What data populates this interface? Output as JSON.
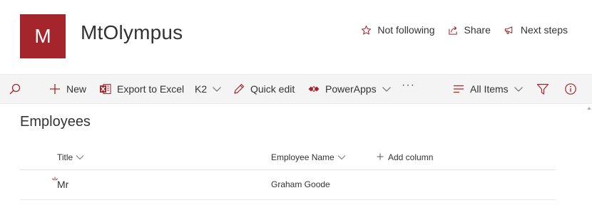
{
  "site": {
    "logo_letter": "M",
    "title": "MtOlympus"
  },
  "header_actions": {
    "follow": "Not following",
    "share": "Share",
    "next_steps": "Next steps"
  },
  "command_bar": {
    "new": "New",
    "export": "Export to Excel",
    "k2": "K2",
    "quick_edit": "Quick edit",
    "powerapps": "PowerApps",
    "more": "···",
    "view": "All Items"
  },
  "list": {
    "title": "Employees",
    "columns": {
      "title": "Title",
      "employee_name": "Employee Name",
      "add_column": "Add column"
    },
    "rows": [
      {
        "title": "Mr",
        "employee_name": "Graham Goode"
      }
    ]
  },
  "colors": {
    "accent": "#a4262c",
    "command_bar_bg": "#f4f4f4",
    "text": "#333333"
  },
  "icons": {
    "search": "search-icon",
    "add": "plus-icon",
    "excel": "excel-icon",
    "edit": "pencil-icon",
    "powerapps": "powerapps-icon",
    "view": "lines-icon",
    "filter": "filter-icon",
    "info": "info-icon",
    "follow": "star-icon",
    "share": "share-icon",
    "next_steps": "megaphone-icon"
  }
}
